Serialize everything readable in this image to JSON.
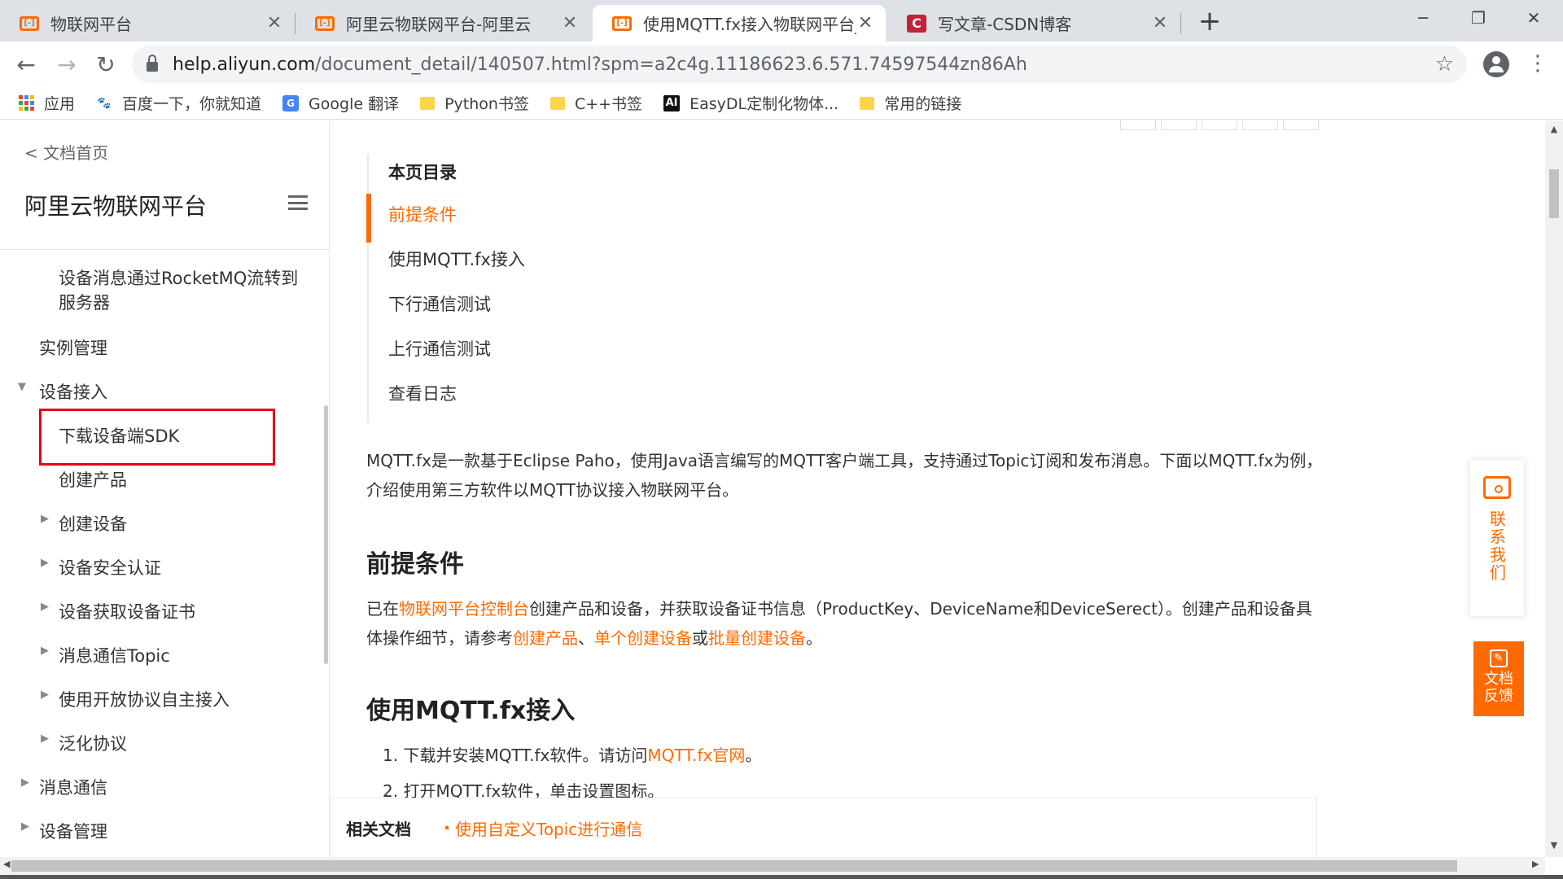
{
  "tabs": [
    {
      "title": "物联网平台",
      "favicon": "aliyun-icon"
    },
    {
      "title": "阿里云物联网平台-阿里云",
      "favicon": "aliyun-icon"
    },
    {
      "title": "使用MQTT.fx接入物联网平台_入",
      "favicon": "aliyun-icon"
    },
    {
      "title": "写文章-CSDN博客",
      "favicon": "csdn-icon"
    }
  ],
  "window": {
    "minimize": "─",
    "restore": "❐",
    "close": "✕"
  },
  "address": {
    "host": "help.aliyun.com",
    "path": "/document_detail/140507.html?spm=a2c4g.11186623.6.571.74597544zn86Ah"
  },
  "bookmarks": [
    {
      "label": "应用",
      "icon": "apps-icon"
    },
    {
      "label": "百度一下，你就知道",
      "icon": "baidu-icon"
    },
    {
      "label": "Google 翻译",
      "icon": "google-translate-icon"
    },
    {
      "label": "Python书签",
      "icon": "folder-icon"
    },
    {
      "label": "C++书签",
      "icon": "folder-icon"
    },
    {
      "label": "EasyDL定制化物体...",
      "icon": "ai-icon"
    },
    {
      "label": "常用的链接",
      "icon": "folder-icon"
    }
  ],
  "sidebar": {
    "back": "< 文档首页",
    "title": "阿里云物联网平台",
    "items": [
      {
        "label": "设备消息通过RocketMQ流转到"
      },
      {
        "label": "服务器"
      },
      {
        "label": "实例管理"
      },
      {
        "label": "设备接入"
      },
      {
        "label": "下载设备端SDK"
      },
      {
        "label": "创建产品"
      },
      {
        "label": "创建设备"
      },
      {
        "label": "设备安全认证"
      },
      {
        "label": "设备获取设备证书"
      },
      {
        "label": "消息通信Topic"
      },
      {
        "label": "使用开放协议自主接入"
      },
      {
        "label": "泛化协议"
      },
      {
        "label": "消息通信"
      },
      {
        "label": "设备管理"
      }
    ]
  },
  "toc": {
    "heading": "本页目录",
    "items": [
      "前提条件",
      "使用MQTT.fx接入",
      "下行通信测试",
      "上行通信测试",
      "查看日志"
    ]
  },
  "article": {
    "intro": "MQTT.fx是一款基于Eclipse Paho，使用Java语言编写的MQTT客户端工具，支持通过Topic订阅和发布消息。下面以MQTT.fx为例，介绍使用第三方软件以MQTT协议接入物联网平台。",
    "h_prereq": "前提条件",
    "prereq": {
      "t1": "已在",
      "l1": "物联网平台控制台",
      "t2": "创建产品和设备，并获取设备证书信息（ProductKey、DeviceName和DeviceSerect）。创建产品和设备具体操作细节，请参考",
      "l2": "创建产品",
      "t3": "、",
      "l3": "单个创建设备",
      "t4": "或",
      "l4": "批量创建设备",
      "t5": "。"
    },
    "h_mqtt": "使用MQTT.fx接入",
    "steps": {
      "s1_text": "1. 下载并安装MQTT.fx软件。请访问",
      "s1_link": "MQTT.fx官网",
      "s1_end": "。",
      "s2_text": "2. 打开MQTT.fx软件，单击设置图标。"
    }
  },
  "related": {
    "label": "相关文档",
    "link": "使用自定义Topic进行通信"
  },
  "floating": {
    "contact": "联系我们",
    "feedback_1": "文档",
    "feedback_2": "反馈"
  },
  "colors": {
    "accent": "#ff6a00",
    "highlight_box": "#e60012"
  }
}
